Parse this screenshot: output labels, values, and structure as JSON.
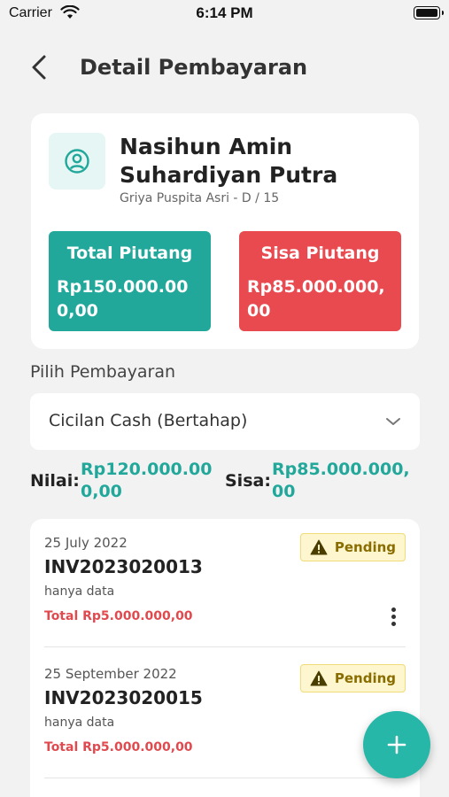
{
  "status_bar": {
    "carrier": "Carrier",
    "time": "6:14 PM"
  },
  "header": {
    "title": "Detail Pembayaran",
    "back_icon": "chevron-left-icon"
  },
  "customer": {
    "name": "Nasihun Amin Suhardiyan Putra",
    "address": "Griya Puspita Asri - D / 15",
    "avatar_icon": "user-circle-icon"
  },
  "stats": {
    "total_label": "Total Piutang",
    "total_value": "Rp150.000.000,00",
    "sisa_label": "Sisa Piutang",
    "sisa_value": "Rp85.000.000,00"
  },
  "payment": {
    "section_label": "Pilih Pembayaran",
    "selected": "Cicilan Cash (Bertahap)"
  },
  "summary": {
    "nilai_label": "Nilai:",
    "nilai_value": "Rp120.000.000,00",
    "sisa_label": "Sisa:",
    "sisa_value": "Rp85.000.000,00"
  },
  "invoices": [
    {
      "date": "25 July 2022",
      "number": "INV2023020013",
      "note": "hanya data",
      "total": "Total Rp5.000.000,00",
      "status": "Pending"
    },
    {
      "date": "25 September 2022",
      "number": "INV2023020015",
      "note": "hanya data",
      "total": "Total Rp5.000.000,00",
      "status": "Pending"
    }
  ],
  "colors": {
    "teal": "#22a89b",
    "red": "#e84a50",
    "pending_bg": "#fdf6cf",
    "fab": "#26b7a8"
  }
}
